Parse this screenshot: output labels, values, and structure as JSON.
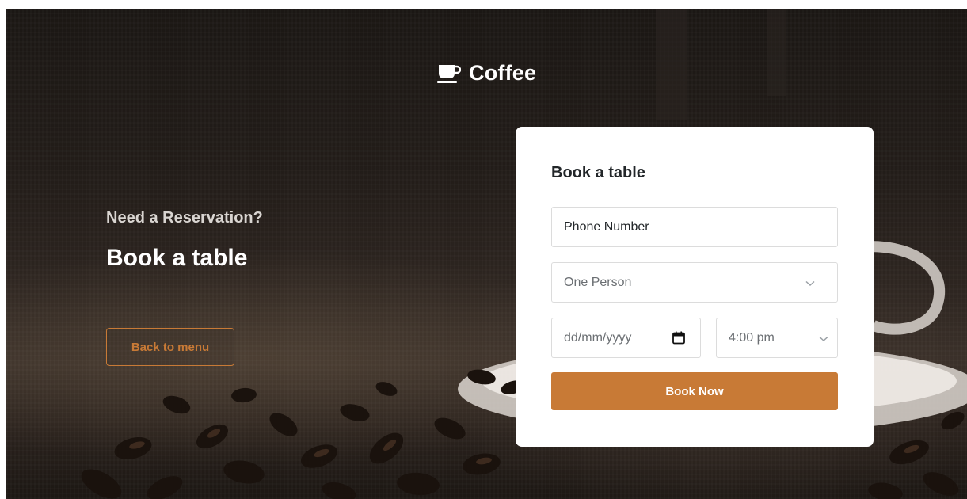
{
  "brand": {
    "name": "Coffee",
    "icon": "coffee-cup-icon"
  },
  "hero": {
    "kicker": "Need a Reservation?",
    "title": "Book a table",
    "back_button_label": "Back to menu"
  },
  "form": {
    "title": "Book a table",
    "phone_value": "Phone Number",
    "persons_selected": "One Person",
    "date_placeholder": "dd/mm/yyyy",
    "time_selected": "4:00 pm",
    "submit_label": "Book Now"
  },
  "colors": {
    "accent": "#c87a36",
    "card_background": "#ffffff",
    "page_background": "#231d19"
  }
}
